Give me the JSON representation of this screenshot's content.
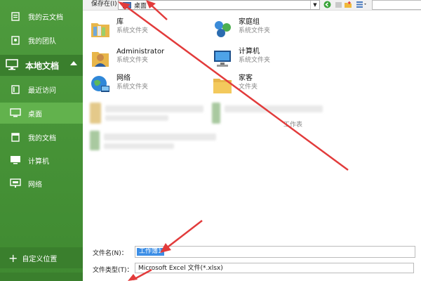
{
  "sidebar": {
    "cloud_items": [
      {
        "label": "我的云文档",
        "icon": "cloud-doc-icon"
      },
      {
        "label": "我的团队",
        "icon": "team-icon"
      }
    ],
    "section_title": "本地文档",
    "local_items": [
      {
        "label": "最近访问",
        "icon": "recent-folder-icon"
      },
      {
        "label": "桌面",
        "icon": "desktop-icon",
        "active": true
      },
      {
        "label": "我的文档",
        "icon": "my-documents-icon"
      },
      {
        "label": "计算机",
        "icon": "computer-icon"
      },
      {
        "label": "网络",
        "icon": "network-icon"
      }
    ],
    "custom_location": "自定义位置"
  },
  "toolbar": {
    "save_in_label": "保存在(I)：",
    "save_in_value": "桌面"
  },
  "files": [
    {
      "name": "库",
      "sub": "系统文件夹",
      "icon": "library-icon"
    },
    {
      "name": "家庭组",
      "sub": "系统文件夹",
      "icon": "homegroup-icon"
    },
    {
      "name": "Administrator",
      "sub": "系统文件夹",
      "icon": "user-folder-icon"
    },
    {
      "name": "计算机",
      "sub": "系统文件夹",
      "icon": "computer-icon"
    },
    {
      "name": "网络",
      "sub": "系统文件夹",
      "icon": "network-globe-icon"
    },
    {
      "name": "家客",
      "sub": "文件夹",
      "icon": "folder-icon"
    }
  ],
  "blurred_caption": "工作表",
  "filename": {
    "label": "文件名(N)：",
    "value": "工作簿1"
  },
  "filetype": {
    "label": "文件类型(T)：",
    "value": "Microsoft Excel 文件(*.xlsx)"
  },
  "colors": {
    "sidebar_green": "#4e9b3d",
    "active_green": "#62b24d",
    "arrow_red": "#e23b3b",
    "selection_blue": "#3c8ee6"
  }
}
